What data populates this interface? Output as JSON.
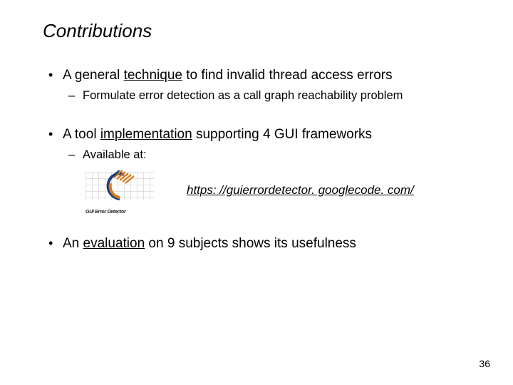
{
  "title": "Contributions",
  "bullets": [
    {
      "prefix": "A general ",
      "underlined": "technique",
      "suffix": " to find invalid thread access errors",
      "sub": "Formulate error detection as a call graph reachability problem"
    },
    {
      "prefix": "A tool ",
      "underlined": "implementation",
      "suffix": " supporting 4 GUI frameworks",
      "sub": "Available at:"
    },
    {
      "prefix": "An ",
      "underlined": "evaluation",
      "suffix": " on 9 subjects shows its usefulness"
    }
  ],
  "logo_caption": "GUI Error Detector",
  "link": "https: //guierrordetector. googlecode. com/",
  "page_number": "36"
}
